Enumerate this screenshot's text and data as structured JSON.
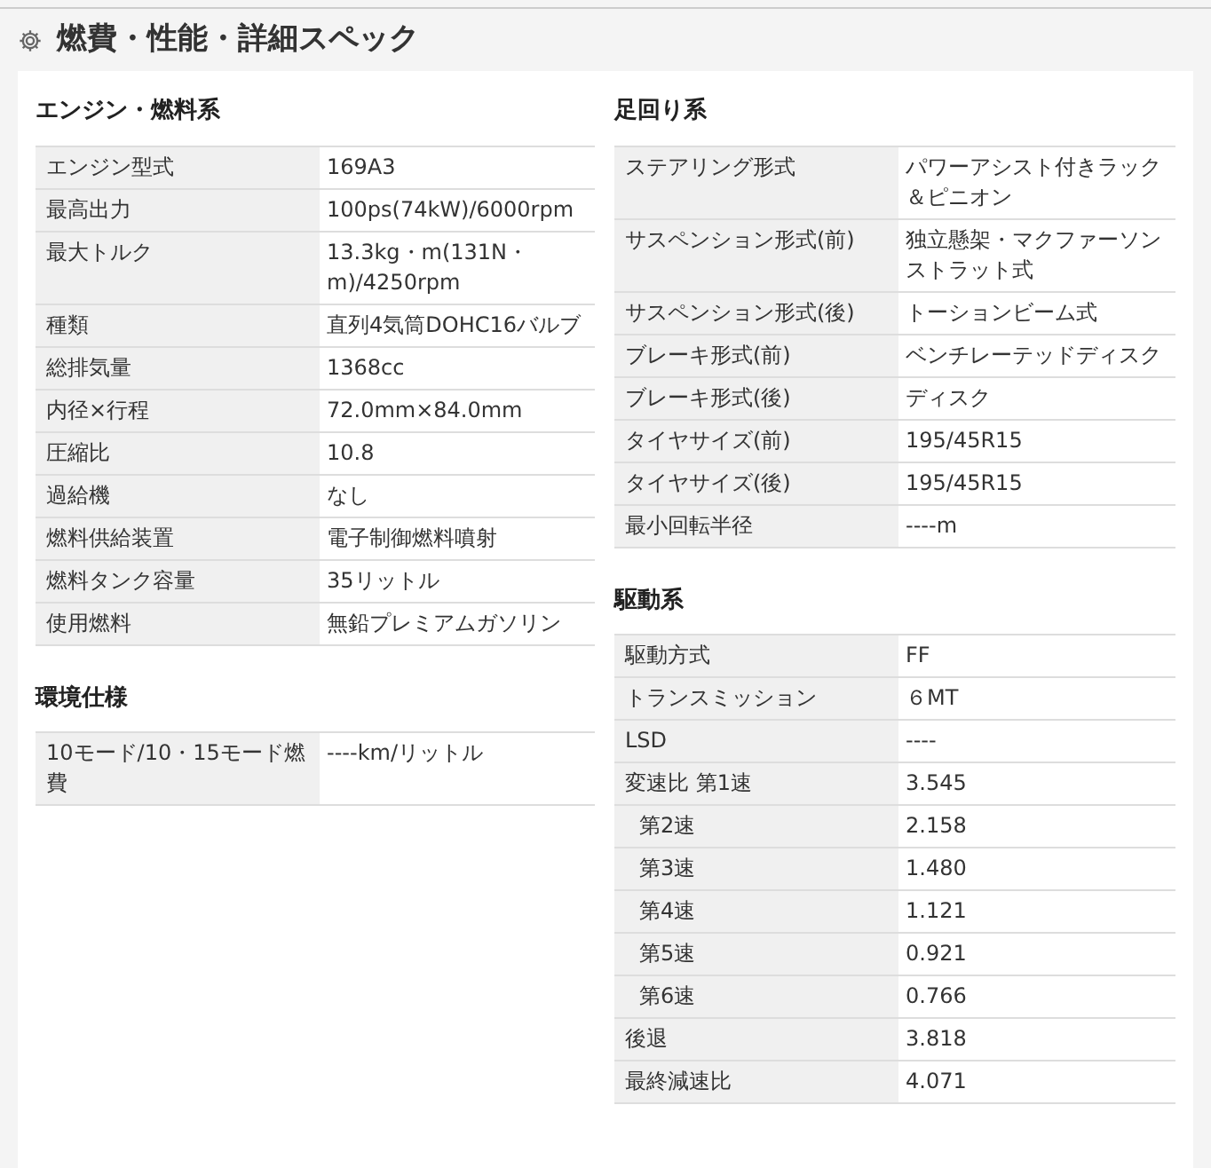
{
  "title": "燃費・性能・詳細スペック",
  "left": [
    {
      "heading": "エンジン・燃料系",
      "rows": [
        {
          "kind": "main",
          "label": "エンジン型式",
          "value": "169A3"
        },
        {
          "kind": "main",
          "label": "最高出力",
          "value": "100ps(74kW)/6000rpm"
        },
        {
          "kind": "main",
          "label": "最大トルク",
          "value": "13.3kg・m(131N・m)/4250rpm"
        },
        {
          "kind": "main",
          "label": "種類",
          "value": "直列4気筒DOHC16バルブ"
        },
        {
          "kind": "main",
          "label": "総排気量",
          "value": "1368cc"
        },
        {
          "kind": "main",
          "label": "内径×行程",
          "value": "72.0mm×84.0mm"
        },
        {
          "kind": "main",
          "label": "圧縮比",
          "value": "10.8"
        },
        {
          "kind": "main",
          "label": "過給機",
          "value": "なし"
        },
        {
          "kind": "main",
          "label": "燃料供給装置",
          "value": "電子制御燃料噴射"
        },
        {
          "kind": "main",
          "label": "燃料タンク容量",
          "value": "35リットル"
        },
        {
          "kind": "main",
          "label": "使用燃料",
          "value": "無鉛プレミアムガソリン"
        }
      ]
    },
    {
      "heading": "環境仕様",
      "rows": [
        {
          "kind": "main",
          "label": "10モード/10・15モード燃費",
          "value": "----km/リットル"
        }
      ]
    }
  ],
  "right": [
    {
      "heading": "足回り系",
      "rows": [
        {
          "kind": "main",
          "label": "ステアリング形式",
          "value": "パワーアシスト付きラック＆ピニオン"
        },
        {
          "kind": "main",
          "label": "サスペンション形式(前)",
          "value": "独立懸架・マクファーソンストラット式"
        },
        {
          "kind": "main",
          "label": "サスペンション形式(後)",
          "value": "トーションビーム式"
        },
        {
          "kind": "main",
          "label": "ブレーキ形式(前)",
          "value": "ベンチレーテッドディスク"
        },
        {
          "kind": "main",
          "label": "ブレーキ形式(後)",
          "value": "ディスク"
        },
        {
          "kind": "main",
          "label": "タイヤサイズ(前)",
          "value": "195/45R15"
        },
        {
          "kind": "main",
          "label": "タイヤサイズ(後)",
          "value": "195/45R15"
        },
        {
          "kind": "main",
          "label": "最小回転半径",
          "value": "----m"
        }
      ]
    },
    {
      "heading": "駆動系",
      "rows": [
        {
          "kind": "main",
          "label": "駆動方式",
          "value": "FF"
        },
        {
          "kind": "main",
          "label": "トランスミッション",
          "value": "６MT"
        },
        {
          "kind": "main",
          "label": "LSD",
          "value": "----"
        },
        {
          "kind": "main",
          "label": "変速比 第1速",
          "value": "3.545"
        },
        {
          "kind": "sub",
          "label": "第2速",
          "value": "2.158"
        },
        {
          "kind": "sub",
          "label": "第3速",
          "value": "1.480"
        },
        {
          "kind": "sub",
          "label": "第4速",
          "value": "1.121"
        },
        {
          "kind": "sub",
          "label": "第5速",
          "value": "0.921"
        },
        {
          "kind": "sub",
          "label": "第6速",
          "value": "0.766"
        },
        {
          "kind": "main",
          "label": "後退",
          "value": "3.818"
        },
        {
          "kind": "main",
          "label": "最終減速比",
          "value": "4.071"
        }
      ]
    }
  ]
}
